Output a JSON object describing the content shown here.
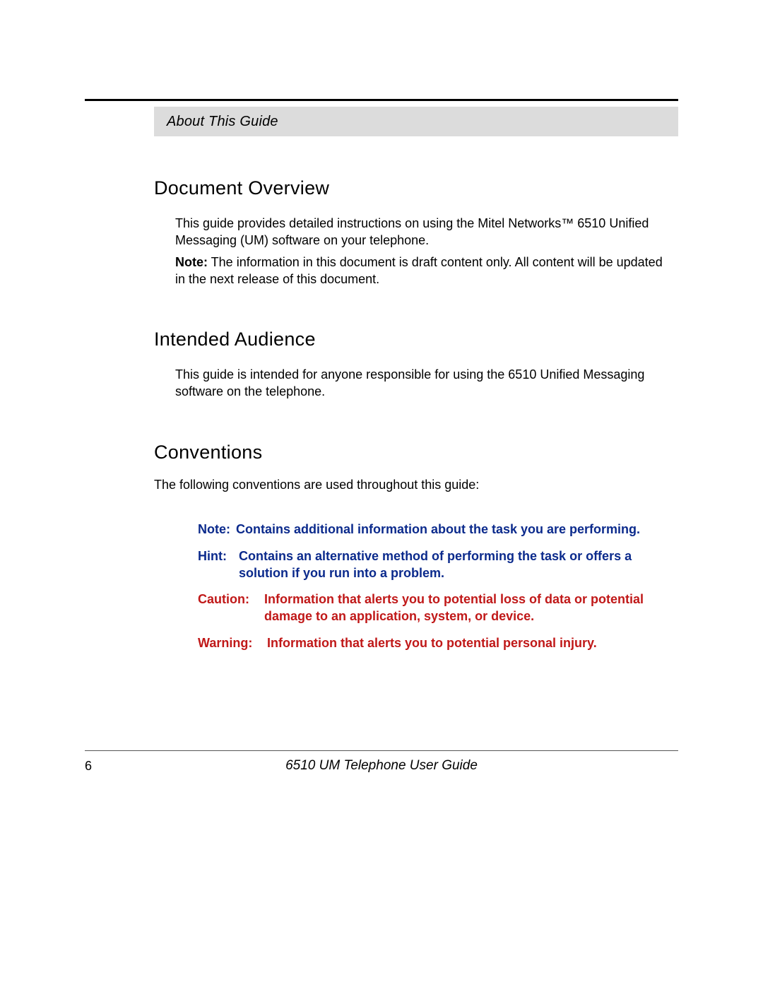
{
  "header": {
    "section_title": "About This Guide"
  },
  "sections": {
    "overview": {
      "heading": "Document Overview",
      "p1": "This guide provides detailed instructions on using the Mitel Networks™ 6510 Unified Messaging (UM) software on your telephone.",
      "note_label": "Note:",
      "note_body": " The information in this document is draft content only. All content will be updated in the next release of this document."
    },
    "audience": {
      "heading": "Intended Audience",
      "p1": "This guide is intended for anyone responsible for using the 6510 Unified Messaging software on the telephone."
    },
    "conventions": {
      "heading": "Conventions",
      "intro": "The following conventions are used throughout this guide:",
      "items": {
        "note": {
          "label": "Note:",
          "text": "Contains additional information about the task you are performing."
        },
        "hint": {
          "label": "Hint:",
          "text": "Contains an alternative method of performing the task or offers a solution if you run into a problem."
        },
        "caution": {
          "label": "Caution:",
          "text": "Information that alerts you to potential loss of data or potential damage to an application, system, or device."
        },
        "warning": {
          "label": "Warning:",
          "text": "Information that alerts you to potential personal injury."
        }
      }
    }
  },
  "footer": {
    "page_number": "6",
    "doc_title": "6510 UM Telephone User Guide"
  }
}
